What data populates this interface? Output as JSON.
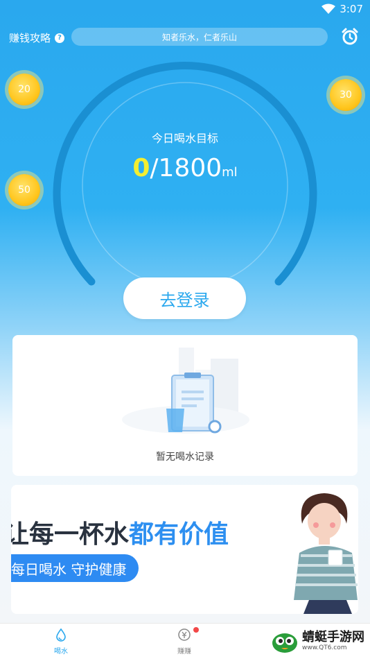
{
  "status_bar": {
    "time": "3:07"
  },
  "header": {
    "earn_label": "赚钱攻略",
    "help_glyph": "?",
    "motto": "知者乐水，仁者乐山"
  },
  "coins": [
    {
      "value": "20"
    },
    {
      "value": "30"
    },
    {
      "value": "50"
    }
  ],
  "goal": {
    "label": "今日喝水目标",
    "current": "0",
    "separator": "/",
    "target": "1800",
    "unit": "ml"
  },
  "login_button": "去登录",
  "record": {
    "empty_text": "暂无喝水记录"
  },
  "banner": {
    "title_dark_1": "让",
    "title_dark_2": "每一杯水",
    "title_blue": "都有价值",
    "subtitle": "每日喝水 守护健康"
  },
  "tabs": [
    {
      "label": "喝水",
      "icon": "water-drop-icon",
      "active": true
    },
    {
      "label": "赚赚",
      "icon": "yuan-coin-icon",
      "active": false
    }
  ],
  "watermark": {
    "name": "蜻蜓手游网",
    "url": "www.QT6.com"
  },
  "colors": {
    "primary": "#2aa8ee",
    "current_value": "#f3ee31",
    "banner_blue": "#2d8ff0",
    "badge_red": "#f24848"
  }
}
